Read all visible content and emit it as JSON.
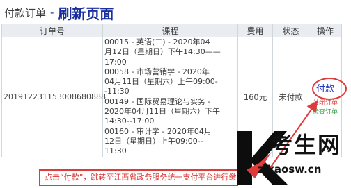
{
  "header": {
    "section_title": "付款订单",
    "separator": "-",
    "refresh_label": "刷新页面"
  },
  "table": {
    "columns": [
      "订单号",
      "课程",
      "费用",
      "状态",
      "操作"
    ],
    "row": {
      "order_id": "201912231153008680888",
      "courses": [
        "00015 - 英语(二) - 2020年04",
        "月12日（星期日）下午14:30——",
        "17:00",
        "00058 - 市场营销学 - 2020年",
        "04月11日（星期六）上午09:00-",
        "-11:30",
        "00149 - 国际贸易理论与实务 -",
        "2020年04月11日（星期六）下午",
        "14:30--17:00",
        "00160 - 审计学 - 2020年04月",
        "12日（星期日）上午09:00--",
        "11:30"
      ],
      "fee": "160元",
      "status": "未付款",
      "actions": {
        "pay": "付款",
        "close": "关闭订单",
        "check": "检查订单"
      }
    }
  },
  "instruction": "点击“付款”，跳转至江西省政务服务统一支付平台进行缴费",
  "watermark": {
    "brand": "考生网",
    "url": "zikaosw.cn"
  },
  "colors": {
    "highlight": "#e03b3b",
    "link": "#1a33c8",
    "title": "#1a2f9e"
  }
}
